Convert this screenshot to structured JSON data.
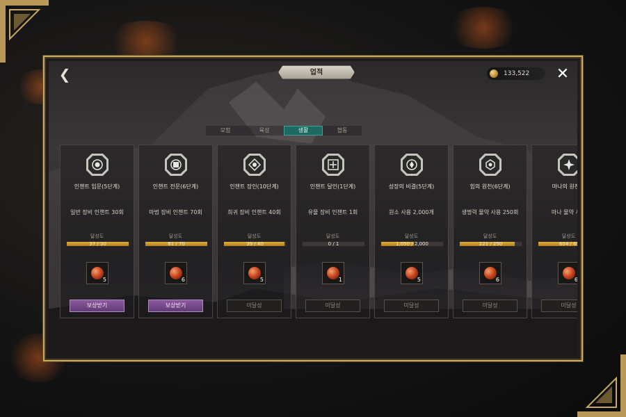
{
  "header": {
    "title": "업적",
    "currency_value": "133,522"
  },
  "tabs": [
    {
      "label": "모험",
      "active": false
    },
    {
      "label": "육성",
      "active": false
    },
    {
      "label": "생활",
      "active": true
    },
    {
      "label": "협동",
      "active": false
    }
  ],
  "cards": [
    {
      "title": "인챈트 입문(5단계)",
      "description": "일반 장비 인챈트 30회",
      "progress_label": "달성도",
      "progress_text": "37 / 30",
      "progress": 1.0,
      "reward_qty": "5",
      "action": "보상받기",
      "claimable": true
    },
    {
      "title": "인챈트 전문(6단계)",
      "description": "마법 장비 인챈트 70회",
      "progress_label": "달성도",
      "progress_text": "81 / 70",
      "progress": 1.0,
      "reward_qty": "6",
      "action": "보상받기",
      "claimable": true
    },
    {
      "title": "인챈트 장인(10단계)",
      "description": "희귀 장비 인챈트 40회",
      "progress_label": "달성도",
      "progress_text": "39 / 40",
      "progress": 0.975,
      "reward_qty": "5",
      "action": "미달성",
      "claimable": false
    },
    {
      "title": "인챈트 달인(1단계)",
      "description": "유물 장비 인챈트 1회",
      "progress_label": "달성도",
      "progress_text": "0 / 1",
      "progress": 0.0,
      "reward_qty": "1",
      "action": "미달성",
      "claimable": false
    },
    {
      "title": "성장의 비결(5단계)",
      "description": "원소 사용 2,000개",
      "progress_label": "달성도",
      "progress_text": "1,050 / 2,000",
      "progress": 0.525,
      "reward_qty": "5",
      "action": "미달성",
      "claimable": false
    },
    {
      "title": "힘의 원천(6단계)",
      "description": "생명력 물약 사용 250회",
      "progress_label": "달성도",
      "progress_text": "221 / 250",
      "progress": 0.884,
      "reward_qty": "6",
      "action": "미달성",
      "claimable": false
    },
    {
      "title": "마나의 원천(1",
      "description": "마나 물약 사용",
      "progress_label": "달성도",
      "progress_text": "604 / 65",
      "progress": 0.93,
      "reward_qty": "6",
      "action": "미달성",
      "claimable": false
    }
  ]
}
